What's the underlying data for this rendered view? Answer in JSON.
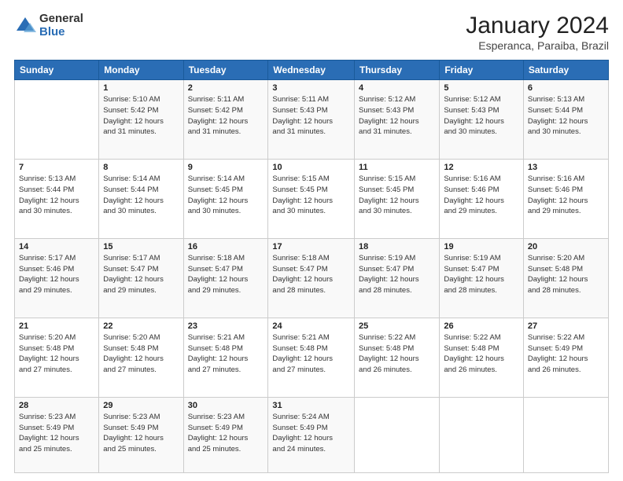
{
  "logo": {
    "general": "General",
    "blue": "Blue"
  },
  "header": {
    "month": "January 2024",
    "location": "Esperanca, Paraiba, Brazil"
  },
  "columns": [
    "Sunday",
    "Monday",
    "Tuesday",
    "Wednesday",
    "Thursday",
    "Friday",
    "Saturday"
  ],
  "weeks": [
    [
      {
        "day": "",
        "info": ""
      },
      {
        "day": "1",
        "info": "Sunrise: 5:10 AM\nSunset: 5:42 PM\nDaylight: 12 hours\nand 31 minutes."
      },
      {
        "day": "2",
        "info": "Sunrise: 5:11 AM\nSunset: 5:42 PM\nDaylight: 12 hours\nand 31 minutes."
      },
      {
        "day": "3",
        "info": "Sunrise: 5:11 AM\nSunset: 5:43 PM\nDaylight: 12 hours\nand 31 minutes."
      },
      {
        "day": "4",
        "info": "Sunrise: 5:12 AM\nSunset: 5:43 PM\nDaylight: 12 hours\nand 31 minutes."
      },
      {
        "day": "5",
        "info": "Sunrise: 5:12 AM\nSunset: 5:43 PM\nDaylight: 12 hours\nand 30 minutes."
      },
      {
        "day": "6",
        "info": "Sunrise: 5:13 AM\nSunset: 5:44 PM\nDaylight: 12 hours\nand 30 minutes."
      }
    ],
    [
      {
        "day": "7",
        "info": "Sunrise: 5:13 AM\nSunset: 5:44 PM\nDaylight: 12 hours\nand 30 minutes."
      },
      {
        "day": "8",
        "info": "Sunrise: 5:14 AM\nSunset: 5:44 PM\nDaylight: 12 hours\nand 30 minutes."
      },
      {
        "day": "9",
        "info": "Sunrise: 5:14 AM\nSunset: 5:45 PM\nDaylight: 12 hours\nand 30 minutes."
      },
      {
        "day": "10",
        "info": "Sunrise: 5:15 AM\nSunset: 5:45 PM\nDaylight: 12 hours\nand 30 minutes."
      },
      {
        "day": "11",
        "info": "Sunrise: 5:15 AM\nSunset: 5:45 PM\nDaylight: 12 hours\nand 30 minutes."
      },
      {
        "day": "12",
        "info": "Sunrise: 5:16 AM\nSunset: 5:46 PM\nDaylight: 12 hours\nand 29 minutes."
      },
      {
        "day": "13",
        "info": "Sunrise: 5:16 AM\nSunset: 5:46 PM\nDaylight: 12 hours\nand 29 minutes."
      }
    ],
    [
      {
        "day": "14",
        "info": "Sunrise: 5:17 AM\nSunset: 5:46 PM\nDaylight: 12 hours\nand 29 minutes."
      },
      {
        "day": "15",
        "info": "Sunrise: 5:17 AM\nSunset: 5:47 PM\nDaylight: 12 hours\nand 29 minutes."
      },
      {
        "day": "16",
        "info": "Sunrise: 5:18 AM\nSunset: 5:47 PM\nDaylight: 12 hours\nand 29 minutes."
      },
      {
        "day": "17",
        "info": "Sunrise: 5:18 AM\nSunset: 5:47 PM\nDaylight: 12 hours\nand 28 minutes."
      },
      {
        "day": "18",
        "info": "Sunrise: 5:19 AM\nSunset: 5:47 PM\nDaylight: 12 hours\nand 28 minutes."
      },
      {
        "day": "19",
        "info": "Sunrise: 5:19 AM\nSunset: 5:47 PM\nDaylight: 12 hours\nand 28 minutes."
      },
      {
        "day": "20",
        "info": "Sunrise: 5:20 AM\nSunset: 5:48 PM\nDaylight: 12 hours\nand 28 minutes."
      }
    ],
    [
      {
        "day": "21",
        "info": "Sunrise: 5:20 AM\nSunset: 5:48 PM\nDaylight: 12 hours\nand 27 minutes."
      },
      {
        "day": "22",
        "info": "Sunrise: 5:20 AM\nSunset: 5:48 PM\nDaylight: 12 hours\nand 27 minutes."
      },
      {
        "day": "23",
        "info": "Sunrise: 5:21 AM\nSunset: 5:48 PM\nDaylight: 12 hours\nand 27 minutes."
      },
      {
        "day": "24",
        "info": "Sunrise: 5:21 AM\nSunset: 5:48 PM\nDaylight: 12 hours\nand 27 minutes."
      },
      {
        "day": "25",
        "info": "Sunrise: 5:22 AM\nSunset: 5:48 PM\nDaylight: 12 hours\nand 26 minutes."
      },
      {
        "day": "26",
        "info": "Sunrise: 5:22 AM\nSunset: 5:48 PM\nDaylight: 12 hours\nand 26 minutes."
      },
      {
        "day": "27",
        "info": "Sunrise: 5:22 AM\nSunset: 5:49 PM\nDaylight: 12 hours\nand 26 minutes."
      }
    ],
    [
      {
        "day": "28",
        "info": "Sunrise: 5:23 AM\nSunset: 5:49 PM\nDaylight: 12 hours\nand 25 minutes."
      },
      {
        "day": "29",
        "info": "Sunrise: 5:23 AM\nSunset: 5:49 PM\nDaylight: 12 hours\nand 25 minutes."
      },
      {
        "day": "30",
        "info": "Sunrise: 5:23 AM\nSunset: 5:49 PM\nDaylight: 12 hours\nand 25 minutes."
      },
      {
        "day": "31",
        "info": "Sunrise: 5:24 AM\nSunset: 5:49 PM\nDaylight: 12 hours\nand 24 minutes."
      },
      {
        "day": "",
        "info": ""
      },
      {
        "day": "",
        "info": ""
      },
      {
        "day": "",
        "info": ""
      }
    ]
  ]
}
